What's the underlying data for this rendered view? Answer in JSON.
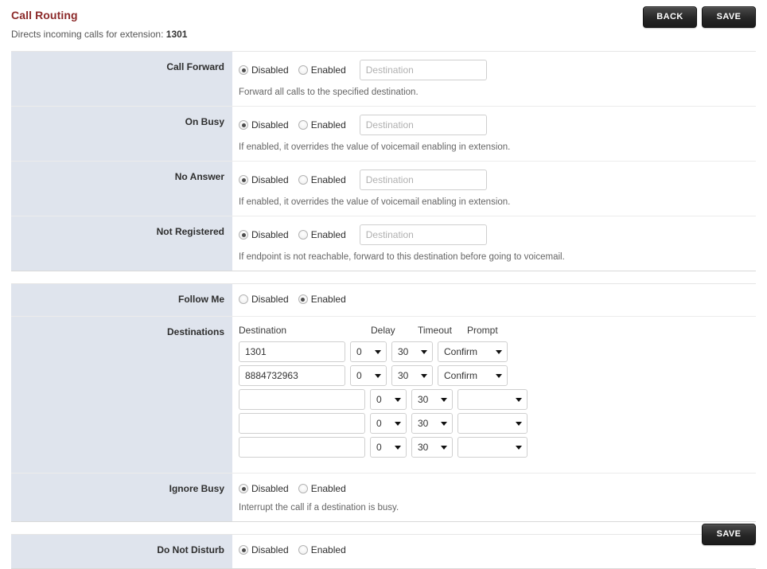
{
  "header": {
    "title": "Call Routing",
    "subtitle_prefix": "Directs incoming calls for extension:",
    "extension": "1301",
    "back_label": "BACK",
    "save_label": "SAVE"
  },
  "footer": {
    "save_label": "SAVE"
  },
  "labels": {
    "disabled": "Disabled",
    "enabled": "Enabled"
  },
  "placeholders": {
    "destination": "Destination"
  },
  "rows": {
    "call_forward": {
      "label": "Call Forward",
      "selected": "Disabled",
      "value": "",
      "hint": "Forward all calls to the specified destination."
    },
    "on_busy": {
      "label": "On Busy",
      "selected": "Disabled",
      "value": "",
      "hint": "If enabled, it overrides the value of voicemail enabling in extension."
    },
    "no_answer": {
      "label": "No Answer",
      "selected": "Disabled",
      "value": "",
      "hint": "If enabled, it overrides the value of voicemail enabling in extension."
    },
    "not_registered": {
      "label": "Not Registered",
      "selected": "Disabled",
      "value": "",
      "hint": "If endpoint is not reachable, forward to this destination before going to voicemail."
    },
    "follow_me": {
      "label": "Follow Me",
      "selected": "Enabled"
    },
    "destinations": {
      "label": "Destinations",
      "columns": {
        "destination": "Destination",
        "delay": "Delay",
        "timeout": "Timeout",
        "prompt": "Prompt"
      },
      "items": [
        {
          "destination": "1301",
          "delay": "0",
          "timeout": "30",
          "prompt": "Confirm"
        },
        {
          "destination": "8884732963",
          "delay": "0",
          "timeout": "30",
          "prompt": "Confirm"
        },
        {
          "destination": "",
          "delay": "0",
          "timeout": "30",
          "prompt": ""
        },
        {
          "destination": "",
          "delay": "0",
          "timeout": "30",
          "prompt": ""
        },
        {
          "destination": "",
          "delay": "0",
          "timeout": "30",
          "prompt": ""
        }
      ]
    },
    "ignore_busy": {
      "label": "Ignore Busy",
      "selected": "Disabled",
      "hint": "Interrupt the call if a destination is busy."
    },
    "do_not_disturb": {
      "label": "Do Not Disturb",
      "selected": "Disabled"
    }
  },
  "colors": {
    "title": "#8c2a2a",
    "label_bg": "#dfe4ed",
    "button_bg": "#262626"
  }
}
